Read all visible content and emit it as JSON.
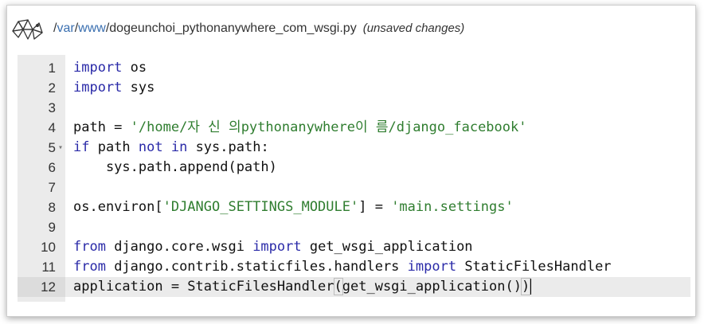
{
  "header": {
    "path_parts": [
      "/var",
      "/www",
      "/"
    ],
    "path_links": [
      "var",
      "www"
    ],
    "filename": "dogeunchoi_pythonanywhere_com_wsgi.py",
    "status": "(unsaved changes)"
  },
  "editor": {
    "active_line": 12,
    "lines": [
      {
        "n": "1",
        "tokens": [
          [
            "kw",
            "import"
          ],
          [
            "plain",
            " os"
          ]
        ]
      },
      {
        "n": "2",
        "tokens": [
          [
            "kw",
            "import"
          ],
          [
            "plain",
            " sys"
          ]
        ]
      },
      {
        "n": "3",
        "tokens": []
      },
      {
        "n": "4",
        "tokens": [
          [
            "plain",
            "path = "
          ],
          [
            "str",
            "'/home/자 신 의pythonanywhere이 름/django_facebook'"
          ]
        ]
      },
      {
        "n": "5",
        "fold": true,
        "tokens": [
          [
            "kw",
            "if"
          ],
          [
            "plain",
            " path "
          ],
          [
            "kw",
            "not in"
          ],
          [
            "plain",
            " sys.path:"
          ]
        ]
      },
      {
        "n": "6",
        "tokens": [
          [
            "plain",
            "    sys.path.append(path)"
          ]
        ]
      },
      {
        "n": "7",
        "tokens": []
      },
      {
        "n": "8",
        "tokens": [
          [
            "plain",
            "os.environ["
          ],
          [
            "str",
            "'DJANGO_SETTINGS_MODULE'"
          ],
          [
            "plain",
            "] = "
          ],
          [
            "str",
            "'main.settings'"
          ]
        ]
      },
      {
        "n": "9",
        "tokens": []
      },
      {
        "n": "10",
        "tokens": [
          [
            "kw",
            "from"
          ],
          [
            "plain",
            " django.core.wsgi "
          ],
          [
            "kw",
            "import"
          ],
          [
            "plain",
            " get_wsgi_application"
          ]
        ]
      },
      {
        "n": "11",
        "tokens": [
          [
            "kw",
            "from"
          ],
          [
            "plain",
            " django.contrib.staticfiles.handlers "
          ],
          [
            "kw",
            "import"
          ],
          [
            "plain",
            " StaticFilesHandler"
          ]
        ]
      },
      {
        "n": "12",
        "tokens": [
          [
            "plain",
            "application = StaticFilesHandler"
          ],
          [
            "paren",
            "("
          ],
          [
            "plain",
            "get_wsgi_application()"
          ],
          [
            "paren",
            ")"
          ],
          [
            "cursor",
            ""
          ]
        ]
      }
    ]
  },
  "icons": {
    "logo": "pythonanywhere-snake-logo-icon",
    "fold": "fold-arrow-icon"
  },
  "colors": {
    "link": "#3a6fb0",
    "keyword": "#2a2aa8",
    "string": "#2f7d2f",
    "gutter": "#ebebeb"
  }
}
